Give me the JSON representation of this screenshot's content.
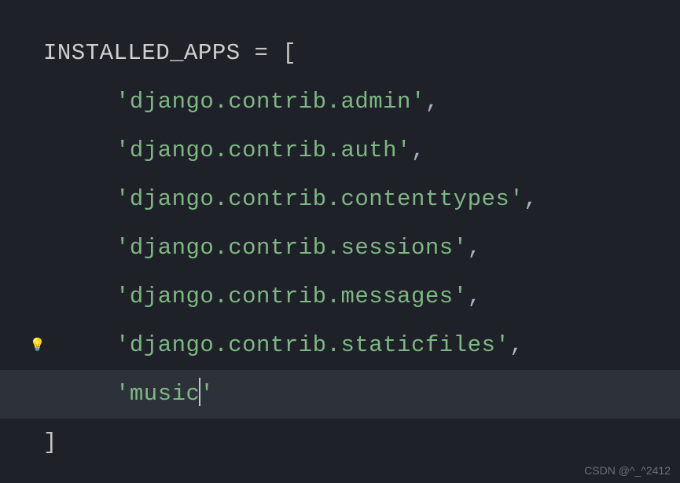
{
  "code": {
    "varName": "INSTALLED_APPS",
    "operator": " = ",
    "openBracket": "[",
    "closeBracket": "]",
    "lines": [
      {
        "text": "'django.contrib.admin'",
        "comma": ","
      },
      {
        "text": "'django.contrib.auth'",
        "comma": ","
      },
      {
        "text": "'django.contrib.contenttypes'",
        "comma": ","
      },
      {
        "text": "'django.contrib.sessions'",
        "comma": ","
      },
      {
        "text": "'django.contrib.messages'",
        "comma": ","
      },
      {
        "text": "'django.contrib.staticfiles'",
        "comma": ","
      },
      {
        "textBefore": "'music",
        "textAfter": "'",
        "hasCursor": true
      }
    ]
  },
  "gutter": {
    "lightbulbLine": 6
  },
  "watermark": "CSDN @^_^2412"
}
